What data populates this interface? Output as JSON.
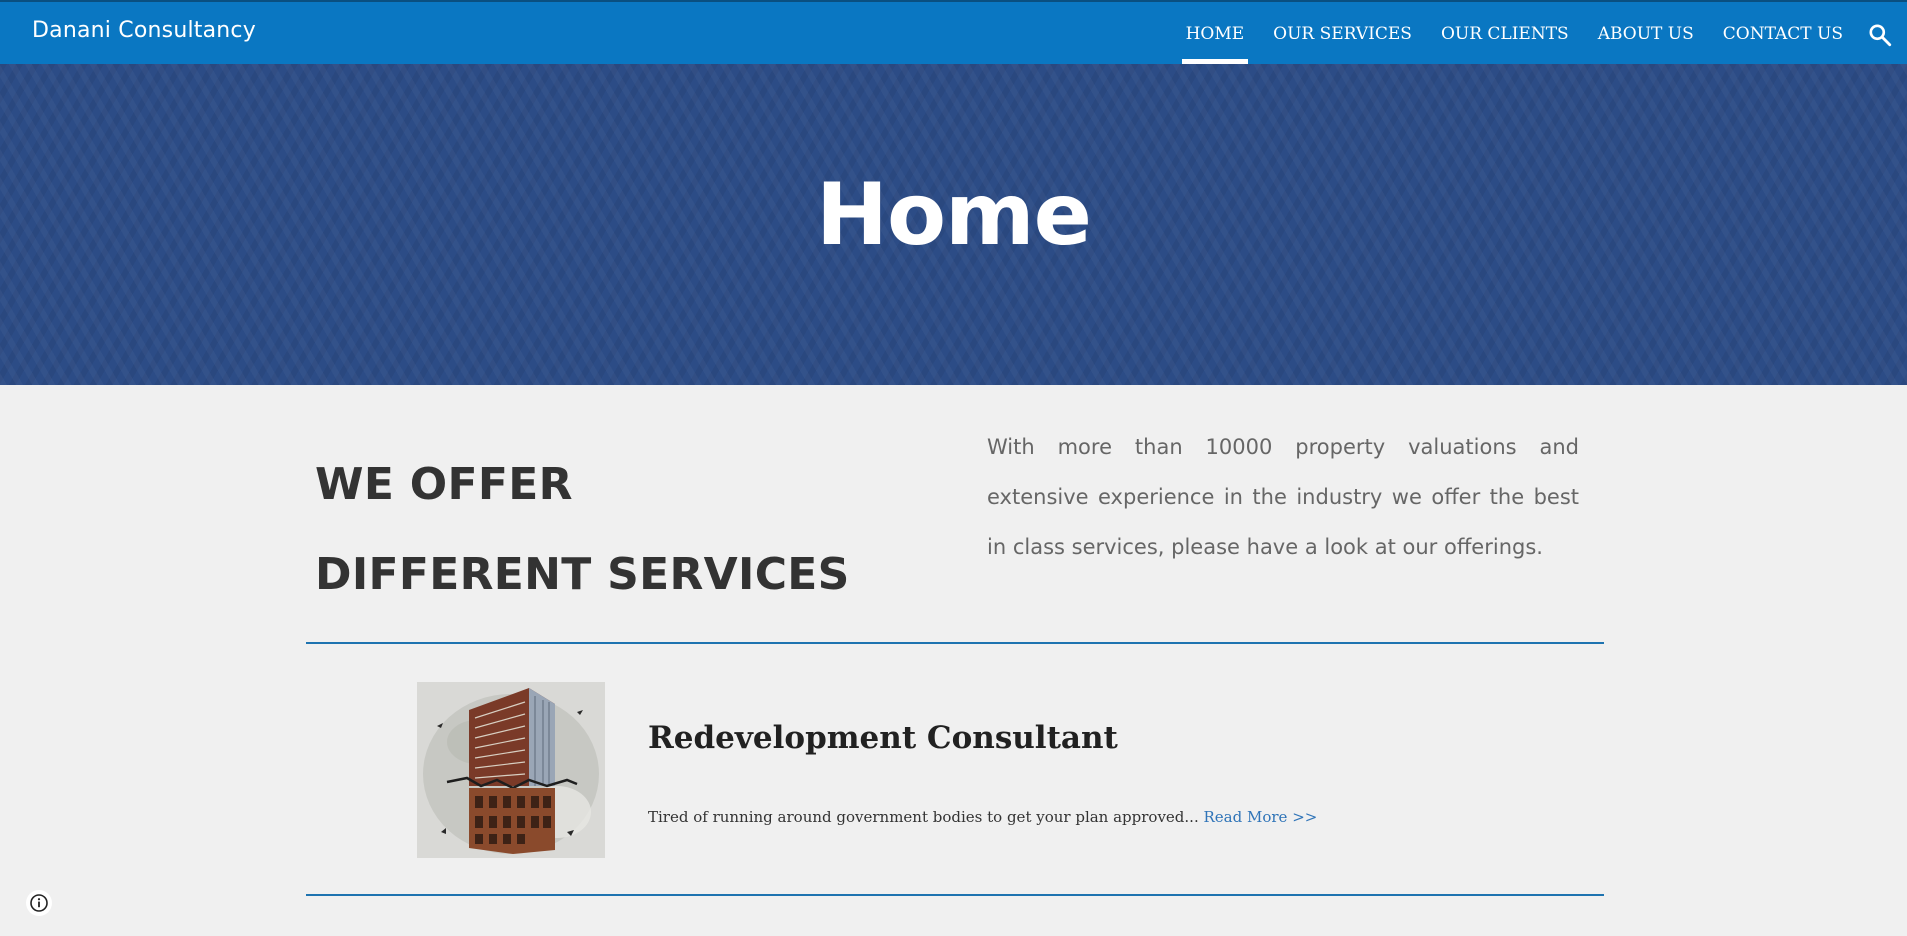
{
  "header": {
    "site_title": "Danani Consultancy",
    "nav": [
      {
        "label": "HOME",
        "active": true
      },
      {
        "label": "OUR SERVICES",
        "active": false
      },
      {
        "label": "OUR CLIENTS",
        "active": false
      },
      {
        "label": "ABOUT US",
        "active": false
      },
      {
        "label": "CONTACT US",
        "active": false
      }
    ],
    "search_icon": "search-icon",
    "colors": {
      "bar": "#0a77c2"
    }
  },
  "hero": {
    "title": "Home",
    "background_color": "#2c4c86"
  },
  "intro": {
    "heading_line1": "WE OFFER",
    "heading_line2": "DIFFERENT SERVICES",
    "text": "With more than 10000 property valuations and extensive experience in the industry we offer the best in class services, please have a look at our offerings."
  },
  "service": {
    "image_icon": "building-illustration",
    "title": "Redevelopment Consultant",
    "description": "Tired of running around government bodies to get your plan approved...",
    "read_more": "Read More >>"
  },
  "footer": {
    "info_icon": "info-icon"
  }
}
